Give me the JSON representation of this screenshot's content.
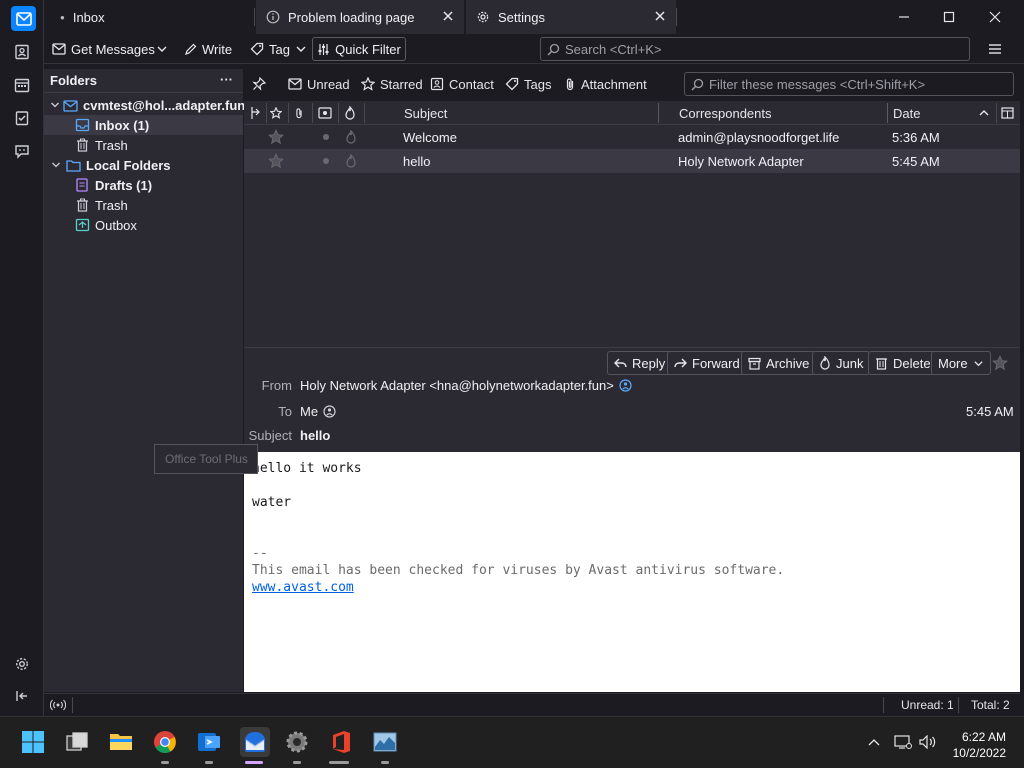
{
  "tabs": [
    {
      "label": "Inbox"
    },
    {
      "label": "Problem loading page"
    },
    {
      "label": "Settings"
    }
  ],
  "toolbar": {
    "get_messages": "Get Messages",
    "write": "Write",
    "tag": "Tag",
    "quick_filter": "Quick Filter",
    "search_placeholder": "Search <Ctrl+K>"
  },
  "folders": {
    "title": "Folders",
    "more": "···",
    "items": [
      {
        "label": "cvmtest@hol...adapter.fun"
      },
      {
        "label": "Inbox (1)"
      },
      {
        "label": "Trash"
      },
      {
        "label": "Local Folders"
      },
      {
        "label": "Drafts (1)"
      },
      {
        "label": "Trash"
      },
      {
        "label": "Outbox"
      }
    ]
  },
  "quickfilter": {
    "unread": "Unread",
    "starred": "Starred",
    "contact": "Contact",
    "tags": "Tags",
    "attachment": "Attachment",
    "filter_placeholder": "Filter these messages <Ctrl+Shift+K>"
  },
  "thread": {
    "columns": {
      "subject": "Subject",
      "correspondents": "Correspondents",
      "date": "Date"
    },
    "rows": [
      {
        "subject": "Welcome",
        "correspondent": "admin@playsnoodforget.life",
        "date": "5:36 AM"
      },
      {
        "subject": "hello",
        "correspondent": "Holy Network Adapter",
        "date": "5:45 AM"
      }
    ]
  },
  "header": {
    "buttons": {
      "reply": "Reply",
      "forward": "Forward",
      "archive": "Archive",
      "junk": "Junk",
      "delete": "Delete",
      "more": "More"
    },
    "from_label": "From",
    "from_value": "Holy Network Adapter <hna@holynetworkadapter.fun>",
    "to_label": "To",
    "to_value": "Me",
    "time": "5:45 AM",
    "subject_label": "Subject",
    "subject_value": "hello"
  },
  "body": {
    "line1": "hello it works",
    "line2": "water",
    "sig_sep": "--",
    "sig_text": "This email has been checked for viruses by Avast antivirus software.",
    "sig_link": "www.avast.com"
  },
  "tooltip": "Office Tool Plus",
  "status": {
    "unread": "Unread: 1",
    "total": "Total: 2"
  },
  "clock": {
    "time": "6:22 AM",
    "date": "10/2/2022"
  },
  "colors": {
    "accent": "#0a84ff",
    "bg_dark": "#1c1b22",
    "pane": "#2b2a33"
  }
}
